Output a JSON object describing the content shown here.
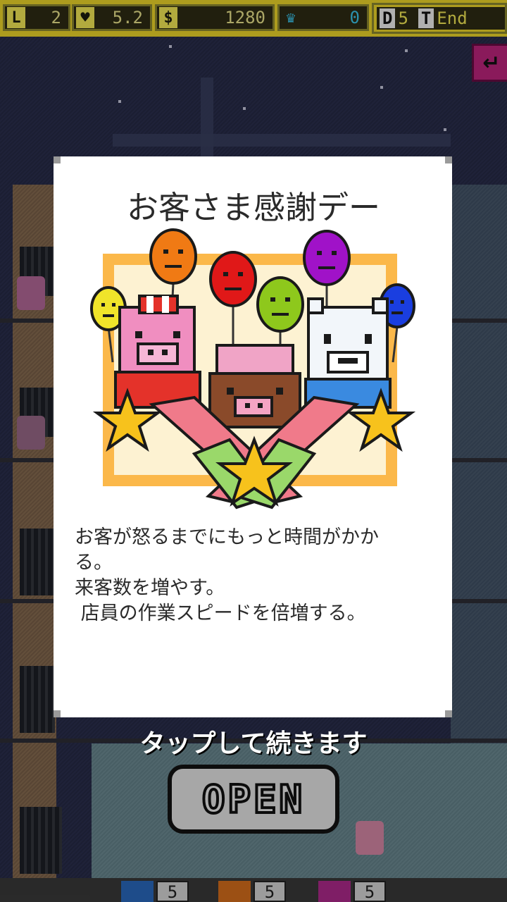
{
  "hud": {
    "level_icon": "L",
    "level": "2",
    "heart_icon": "♥",
    "heart": "5.2",
    "money_icon": "$",
    "money": "1280",
    "crown_icon": "♛",
    "crown": "0",
    "day_label": "D",
    "day": "5",
    "time_label": "T",
    "time": "End"
  },
  "scene": {
    "open_sign": "OPEN",
    "back_icon": "return-arrow-icon"
  },
  "bottom_slots": [
    {
      "icon": "blue-tile-icon",
      "color": "#2a6ac0",
      "count": "5"
    },
    {
      "icon": "orange-tile-icon",
      "color": "#d8701c",
      "count": "5"
    },
    {
      "icon": "pink-tile-icon",
      "color": "#b02a8e",
      "count": "5"
    }
  ],
  "modal": {
    "title": "お客さま感謝デー",
    "lines": [
      "お客が怒るまでにもっと時間がかか",
      "る。",
      "来客数を増やす。",
      " 店員の作業スピードを倍増する。"
    ]
  },
  "tap_text": "タップして続きます",
  "colors": {
    "hud_yellow": "#f0d82a",
    "balloon_orange": "#f07a14",
    "balloon_red": "#e01818",
    "balloon_purple": "#a012c8",
    "balloon_green": "#8ec81c",
    "balloon_blue": "#1a3ee0",
    "balloon_yellow": "#f0e42a",
    "star_gold": "#f7c21c"
  }
}
